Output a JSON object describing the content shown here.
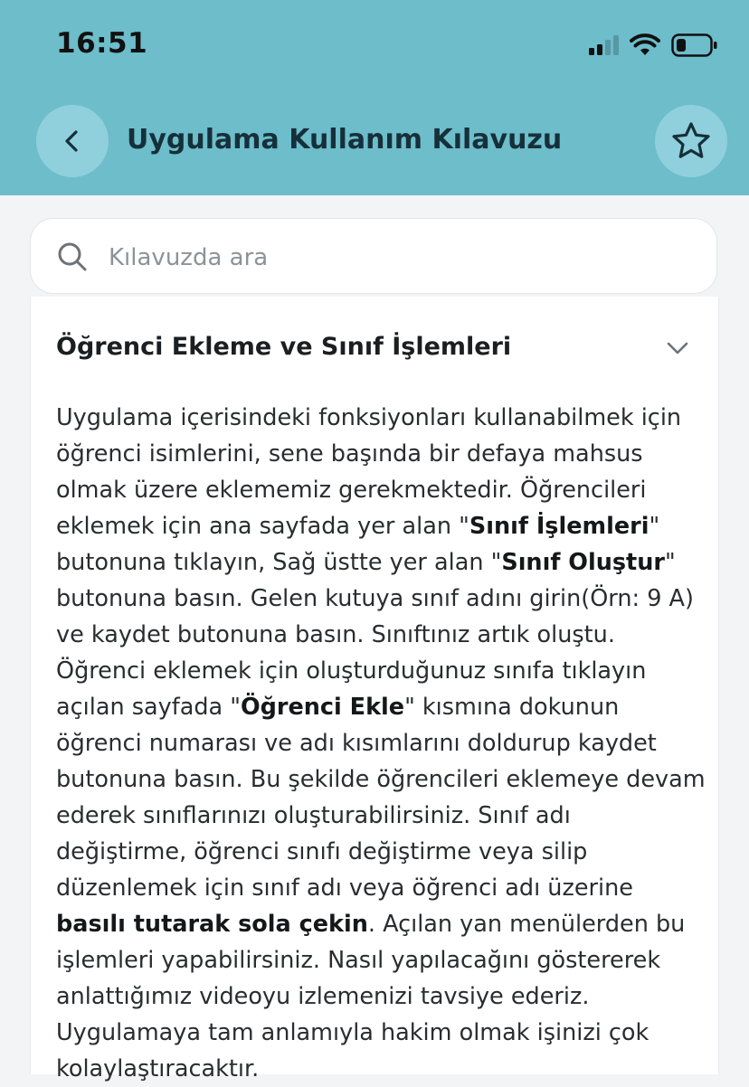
{
  "status_bar": {
    "time": "16:51",
    "icons": [
      "signal-icon",
      "wifi-icon",
      "battery-icon"
    ]
  },
  "header": {
    "title": "Uygulama Kullanım Kılavuzu",
    "back_icon": "chevron-left-icon",
    "favorite_icon": "star-icon"
  },
  "search": {
    "placeholder": "Kılavuzda ara",
    "icon": "search-icon"
  },
  "section": {
    "title": "Öğrenci Ekleme ve Sınıf İşlemleri",
    "expanded": true,
    "segments": [
      {
        "text": "Uygulama içerisindeki fonksiyonları kullanabilmek için öğrenci isimlerini, sene başında bir defaya mahsus olmak üzere eklememiz gerekmektedir. Öğrencileri eklemek için ana sayfada yer alan \"",
        "bold": false
      },
      {
        "text": "Sınıf İşlemleri",
        "bold": true
      },
      {
        "text": "\" butonuna tıklayın, Sağ üstte yer alan \"",
        "bold": false
      },
      {
        "text": "Sınıf Oluştur",
        "bold": true
      },
      {
        "text": "\" butonuna basın. Gelen kutuya sınıf adını girin(Örn: 9 A) ve kaydet butonuna basın. Sınıftınız artık oluştu. Öğrenci eklemek için oluşturduğunuz sınıfa tıklayın açılan sayfada \"",
        "bold": false
      },
      {
        "text": "Öğrenci Ekle",
        "bold": true
      },
      {
        "text": "\" kısmına dokunun öğrenci numarası ve adı kısımlarını doldurup kaydet butonuna basın. Bu şekilde öğrencileri eklemeye devam ederek sınıflarınızı oluşturabilirsiniz. Sınıf adı değiştirme, öğrenci sınıfı değiştirme veya silip düzenlemek için sınıf adı veya öğrenci adı üzerine ",
        "bold": false
      },
      {
        "text": "basılı tutarak sola çekin",
        "bold": true
      },
      {
        "text": ". Açılan yan menülerden bu işlemleri yapabilirsiniz. Nasıl yapılacağını göstererek anlattığımız videoyu izlemenizi tavsiye ederiz. Uygulamaya tam anlamıyla hakim olmak işinizi çok kolaylaştıracaktır.",
        "bold": false
      }
    ]
  },
  "colors": {
    "header_bg": "#6dbdcb",
    "header_button_bg": "#8fd0dc",
    "page_bg": "#f2f4f6"
  }
}
